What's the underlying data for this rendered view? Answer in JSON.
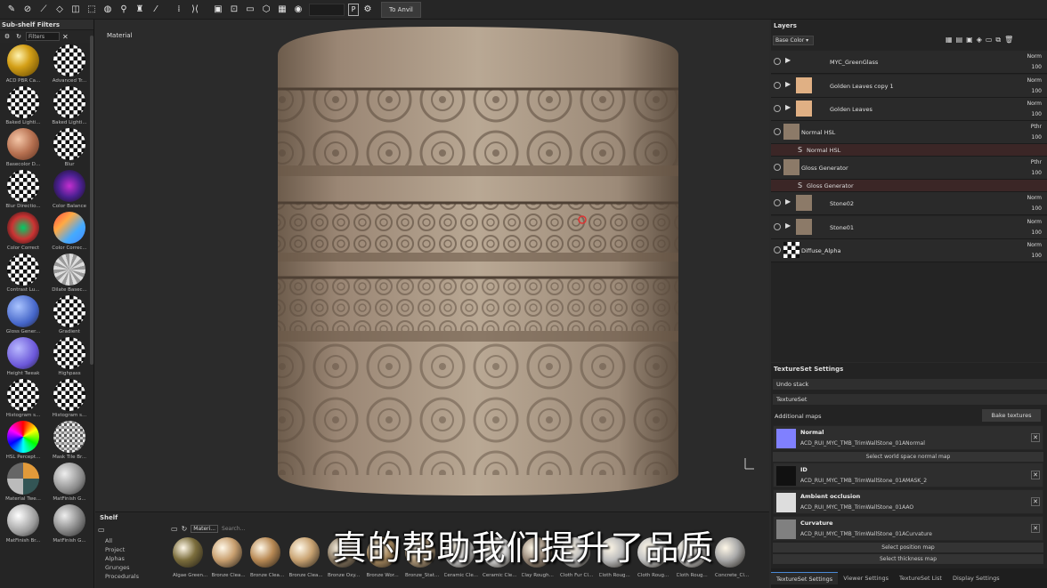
{
  "toolbar": {
    "anvil_label": "To Anvil"
  },
  "subshelf": {
    "title": "Sub-shelf Filters",
    "filter_placeholder": "Filters",
    "items": [
      {
        "label": "ACD PBR Ca..."
      },
      {
        "label": "Advanced Tr..."
      },
      {
        "label": "Baked Lighti..."
      },
      {
        "label": "Baked Lighti..."
      },
      {
        "label": "Basecolor D..."
      },
      {
        "label": "Blur"
      },
      {
        "label": "Blur Directio..."
      },
      {
        "label": "Color Balance"
      },
      {
        "label": "Color Correct"
      },
      {
        "label": "Color Correc..."
      },
      {
        "label": "Contrast Lu..."
      },
      {
        "label": "Dilate Basec..."
      },
      {
        "label": "Gloss Gener..."
      },
      {
        "label": "Gradient"
      },
      {
        "label": "Height Tweak"
      },
      {
        "label": "Highpass"
      },
      {
        "label": "Histogram s..."
      },
      {
        "label": "Histogram s..."
      },
      {
        "label": "HSL Percept..."
      },
      {
        "label": "Mask Tile Br..."
      },
      {
        "label": "Material Twe..."
      },
      {
        "label": "MatFinish G..."
      },
      {
        "label": "MatFinish Br..."
      },
      {
        "label": "MatFinish G..."
      }
    ]
  },
  "viewport": {
    "label": "Material"
  },
  "shelf": {
    "title": "Shelf",
    "tab_label": "Materi...",
    "search_placeholder": "Search...",
    "categories": [
      "All",
      "Project",
      "Alphas",
      "Grunges",
      "Procedurals"
    ],
    "items": [
      {
        "label": "Algae Green..."
      },
      {
        "label": "Bronze Clea..."
      },
      {
        "label": "Bronze Clea..."
      },
      {
        "label": "Bronze Clea..."
      },
      {
        "label": "Bronze Oxy..."
      },
      {
        "label": "Bronze Wor..."
      },
      {
        "label": "Bronze_Stat..."
      },
      {
        "label": "Ceramic Cle..."
      },
      {
        "label": "Ceramic Cle..."
      },
      {
        "label": "Clay Rough..."
      },
      {
        "label": "Cloth Fur Cl..."
      },
      {
        "label": "Cloth Roug..."
      },
      {
        "label": "Cloth Roug..."
      },
      {
        "label": "Cloth Roug..."
      },
      {
        "label": "Concrete_Cl..."
      }
    ]
  },
  "layers": {
    "title": "Layers",
    "channel": "Base Color",
    "rows": [
      {
        "name": "MYC_GreenGlass",
        "mode": "Norm",
        "opacity": "100"
      },
      {
        "name": "Golden Leaves copy 1",
        "mode": "Norm",
        "opacity": "100"
      },
      {
        "name": "Golden Leaves",
        "mode": "Norm",
        "opacity": "100"
      },
      {
        "name": "Normal HSL",
        "mode": "Pthr",
        "opacity": "100"
      },
      {
        "name": "Gloss Generator",
        "mode": "Pthr",
        "opacity": "100"
      },
      {
        "name": "Stone02",
        "mode": "Norm",
        "opacity": "100"
      },
      {
        "name": "Stone01",
        "mode": "Norm",
        "opacity": "100"
      },
      {
        "name": "Diffuse_Alpha",
        "mode": "Norm",
        "opacity": "100"
      }
    ],
    "filters": [
      {
        "name": "Normal HSL"
      },
      {
        "name": "Gloss Generator"
      }
    ]
  },
  "textureset": {
    "title": "TextureSet Settings",
    "undo_stack": "Undo stack",
    "textureset_label": "TextureSet",
    "additional_maps": "Additional maps",
    "bake_button": "Bake textures",
    "maps": [
      {
        "title": "Normal",
        "file": "ACD_RUI_MYC_TMB_TrimWallStone_01ANormal",
        "color": "#8080ff"
      },
      {
        "title": "ID",
        "file": "ACD_RUI_MYC_TMB_TrimWallStone_01AMASK_2",
        "color": "#111111"
      },
      {
        "title": "Ambient occlusion",
        "file": "ACD_RUI_MYC_TMB_TrimWallStone_01AAO",
        "color": "#dddddd"
      },
      {
        "title": "Curvature",
        "file": "ACD_RUI_MYC_TMB_TrimWallStone_01ACurvature",
        "color": "#808080"
      }
    ],
    "select_normal": "Select world space normal map",
    "select_position": "Select position map",
    "select_thickness": "Select thickness map"
  },
  "bottom_tabs": [
    "TextureSet Settings",
    "Viewer Settings",
    "TextureSet List",
    "Display Settings"
  ],
  "subtitle": "真的帮助我们提升了品质"
}
